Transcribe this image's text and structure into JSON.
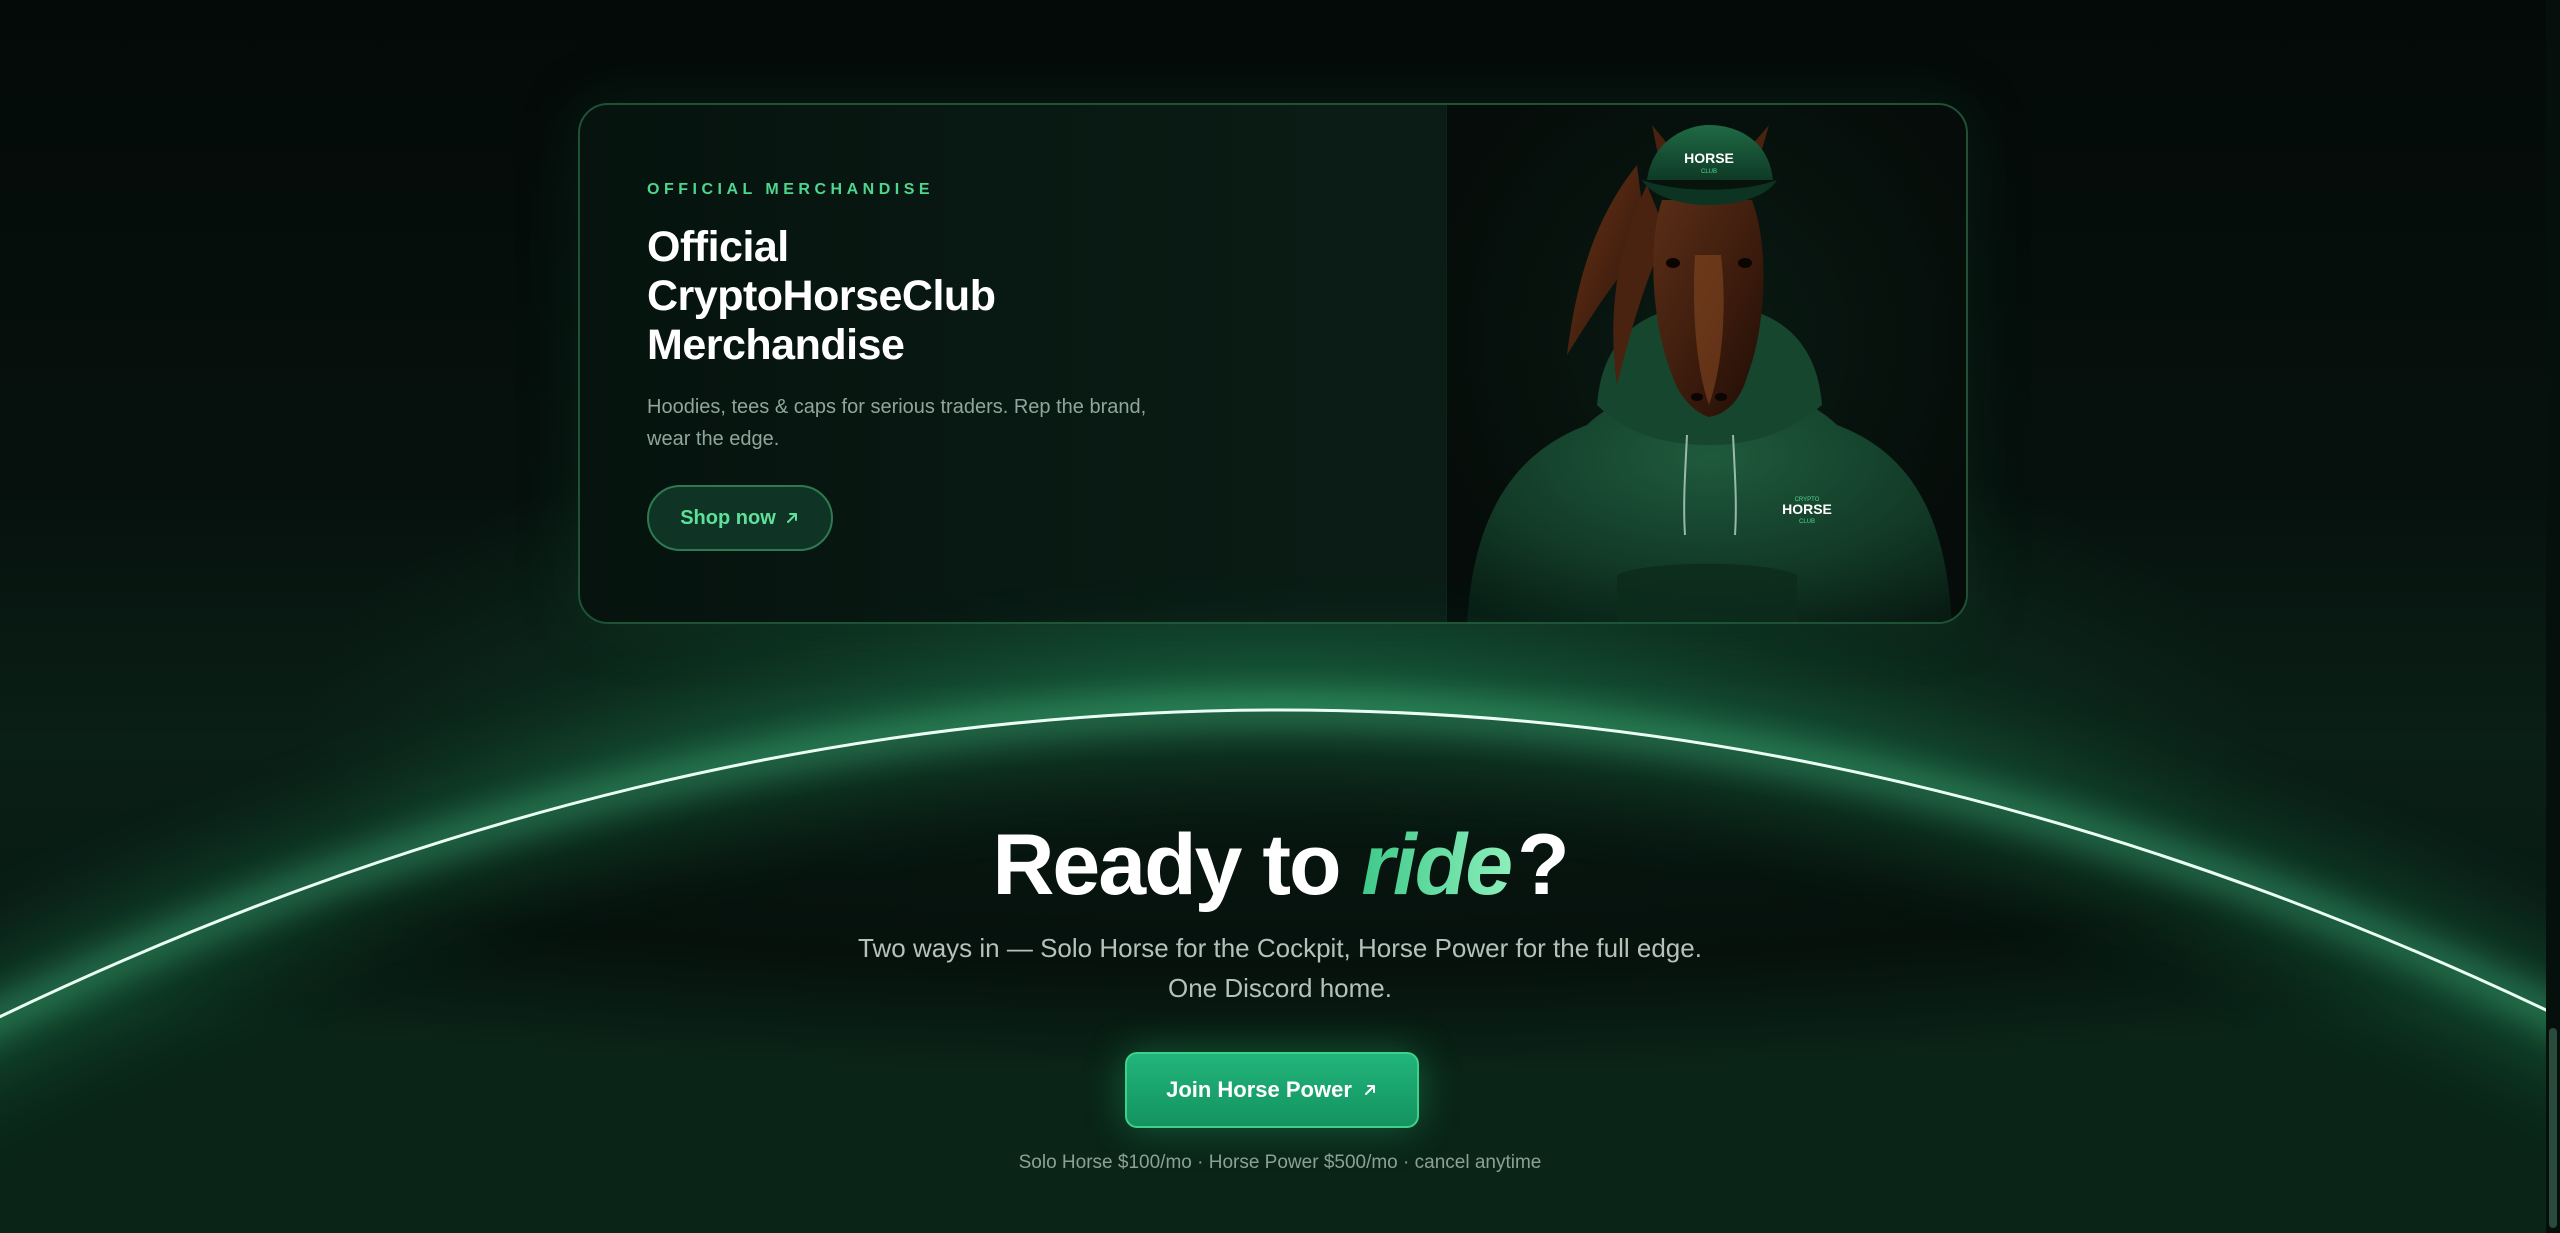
{
  "merch": {
    "eyebrow": "OFFICIAL MERCHANDISE",
    "title_line1": "Official",
    "title_line2": "CryptoHorseClub",
    "title_line3": "Merchandise",
    "description": "Hoodies, tees & caps for serious traders. Rep the brand, wear the edge.",
    "shop_button_label": "Shop now",
    "shop_button_icon": "arrow-up-right-icon",
    "image": {
      "subject": "horse-in-green-hoodie-and-cap",
      "cap_logo_top": "HORSE",
      "cap_logo_sub": "CLUB",
      "hoodie_logo_top": "CRYPTO",
      "hoodie_logo_main": "HORSE",
      "hoodie_logo_sub": "CLUB"
    }
  },
  "cta": {
    "title_prefix": "Ready to ",
    "title_accent": "ride",
    "title_suffix": "?",
    "subtitle_line1": "Two ways in — Solo Horse for the Cockpit, Horse Power for the full edge.",
    "subtitle_line2": "One Discord home.",
    "join_button_label": "Join Horse Power",
    "join_button_icon": "arrow-up-right-icon",
    "pricing_note": "Solo Horse $100/mo · Horse Power $500/mo · cancel anytime"
  },
  "colors": {
    "accent": "#4fd68e",
    "button_green": "#1aa56e",
    "background": "#040a08",
    "card_border": "#1f5136"
  }
}
